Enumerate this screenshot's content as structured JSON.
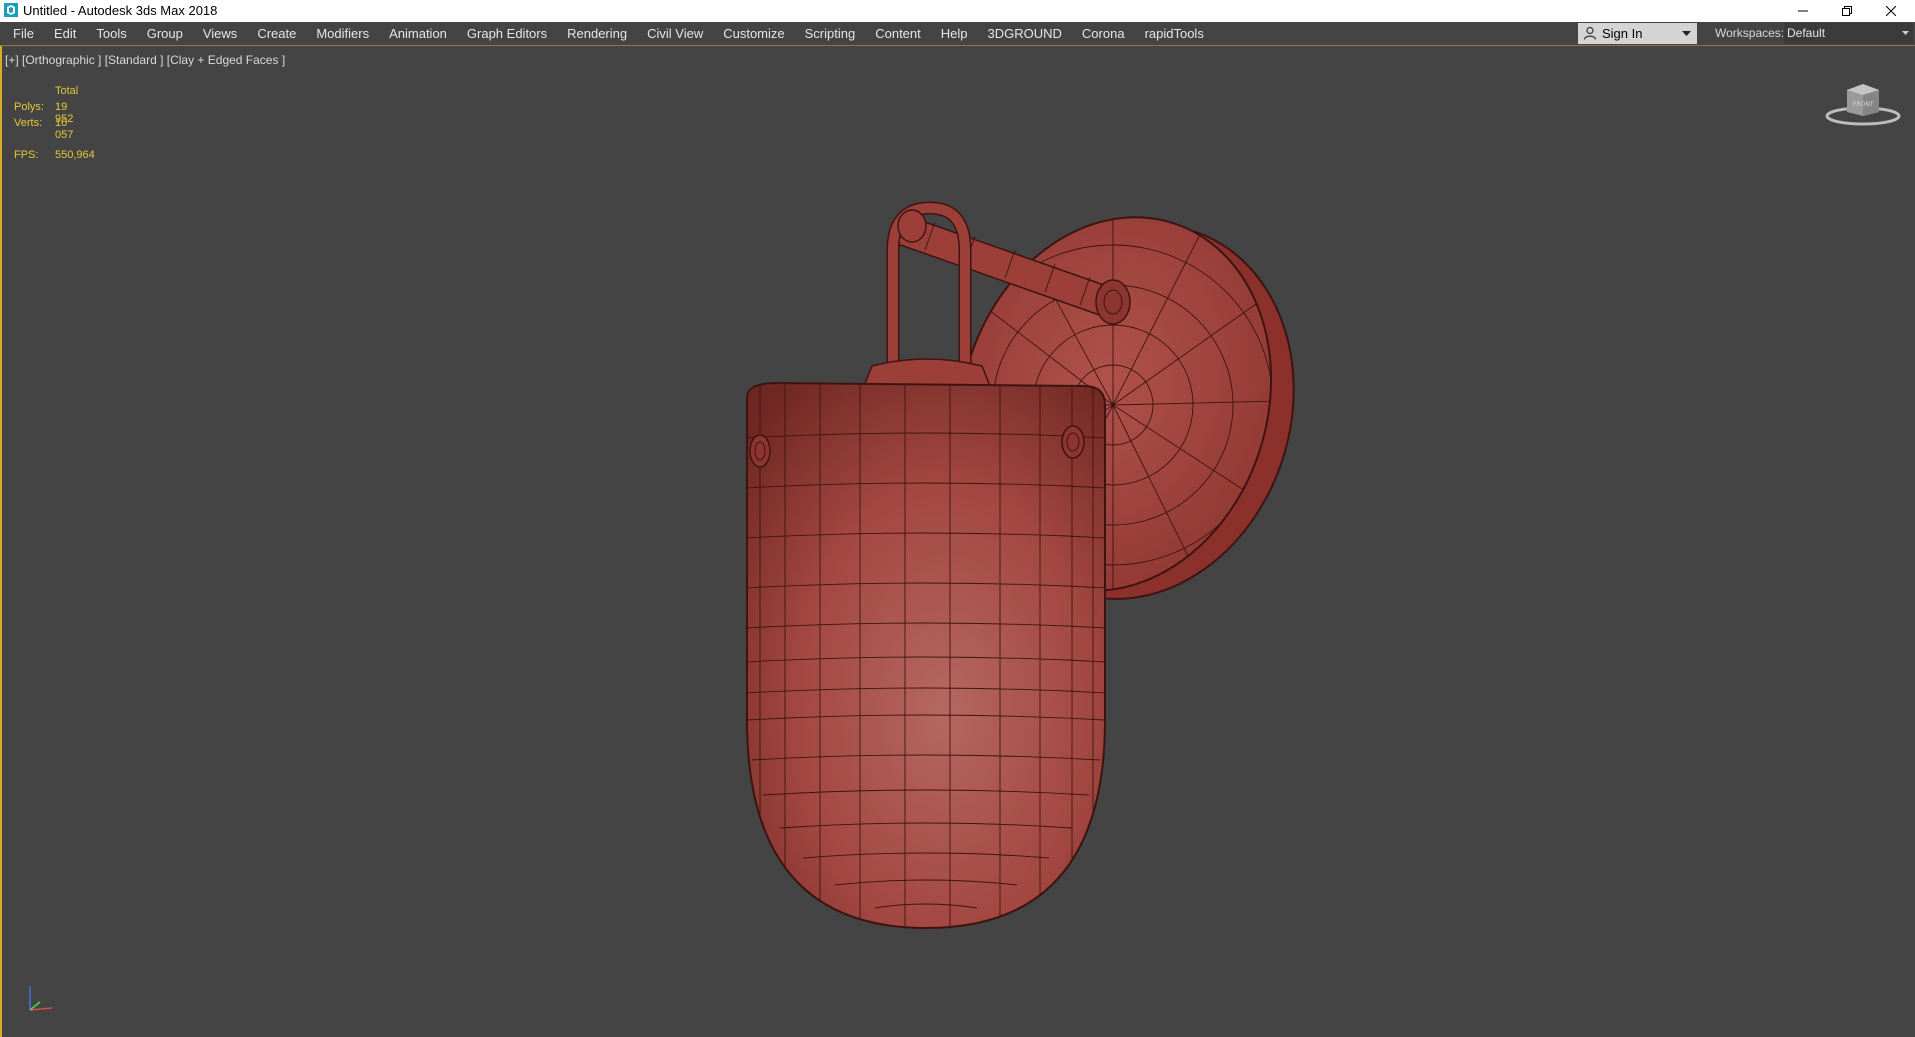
{
  "window": {
    "title": "Untitled - Autodesk 3ds Max 2018",
    "app_icon": "3ds-max-icon",
    "controls": [
      "minimize-icon",
      "restore-icon",
      "close-icon"
    ]
  },
  "menubar": {
    "items": [
      "File",
      "Edit",
      "Tools",
      "Group",
      "Views",
      "Create",
      "Modifiers",
      "Animation",
      "Graph Editors",
      "Rendering",
      "Civil View",
      "Customize",
      "Scripting",
      "Content",
      "Help",
      "3DGROUND",
      "Corona",
      "rapidTools"
    ],
    "sign_in": {
      "icon": "person-icon",
      "label": "Sign In"
    },
    "workspaces": {
      "label": "Workspaces:",
      "value": "Default"
    }
  },
  "viewport": {
    "label": "[+] [Orthographic ] [Standard ] [Clay + Edged Faces ]",
    "stats": {
      "total_label": "Total",
      "polys_label": "Polys:",
      "polys_value": "19 952",
      "verts_label": "Verts:",
      "verts_value": "10 057",
      "fps_label": "FPS:",
      "fps_value": "550,964"
    },
    "colors": {
      "background": "#444444",
      "model": "#a84640",
      "stats_text": "#e6c83a",
      "active_border": "#d6ab2c"
    }
  }
}
